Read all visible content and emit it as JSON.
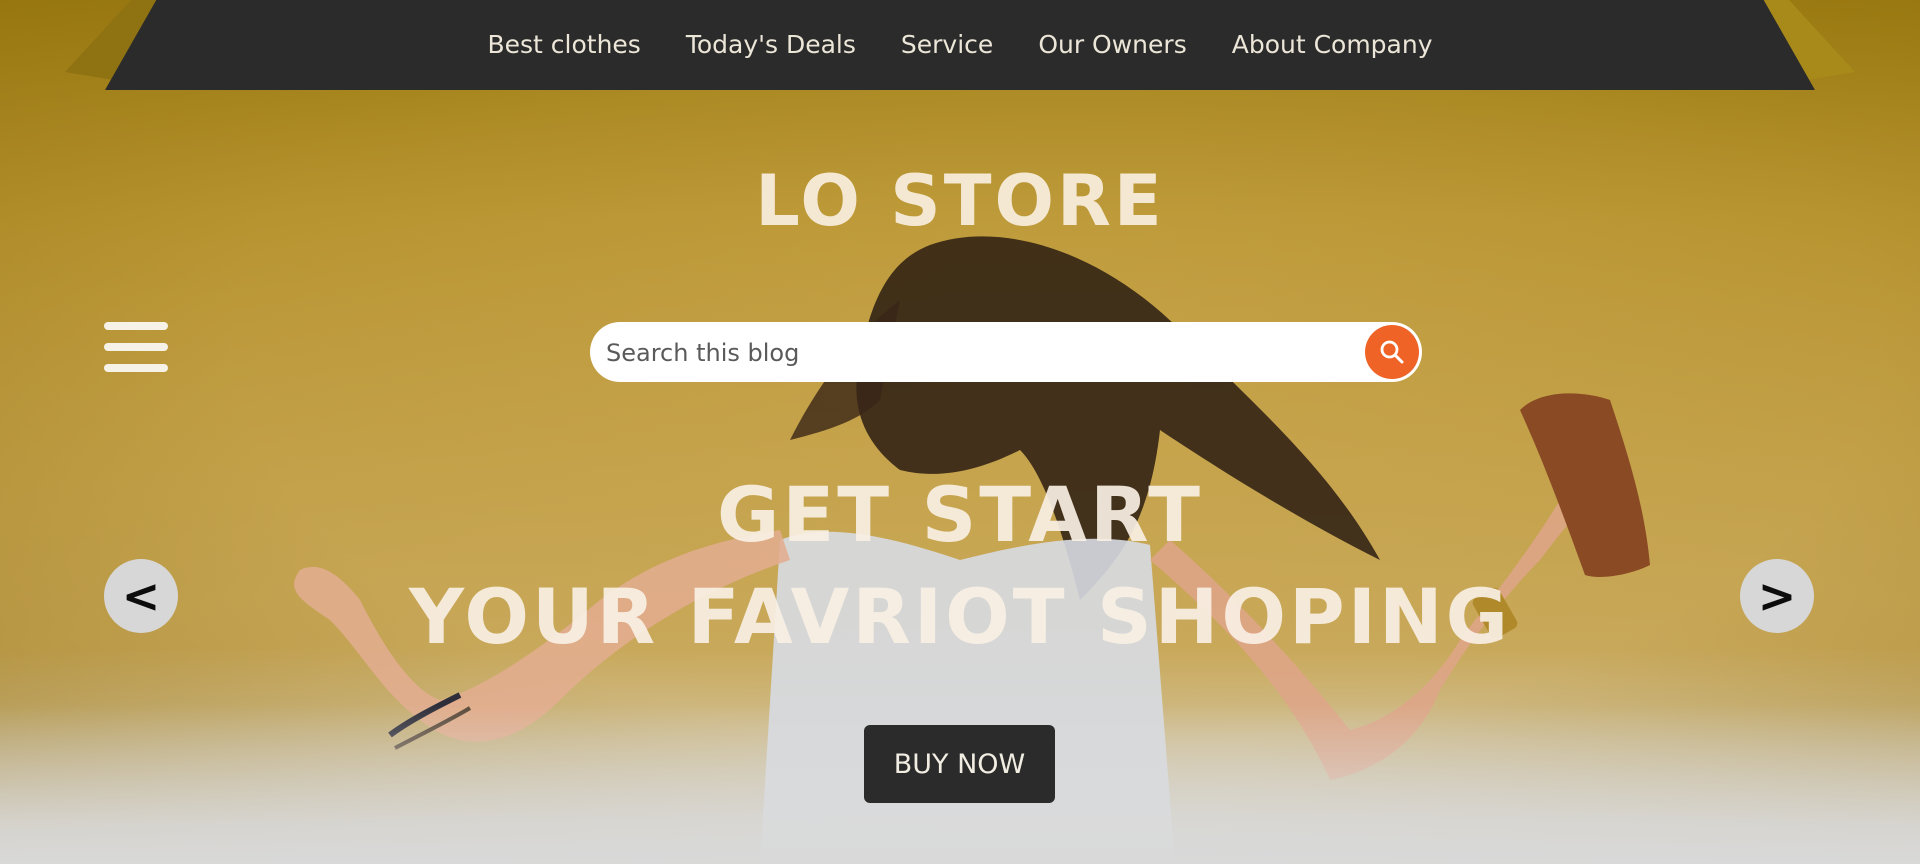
{
  "nav": {
    "items": [
      {
        "label": "Best clothes"
      },
      {
        "label": "Today's Deals"
      },
      {
        "label": "Service"
      },
      {
        "label": "Our Owners"
      },
      {
        "label": "About Company"
      }
    ]
  },
  "brand": {
    "title": "LO STORE"
  },
  "menu": {
    "icon": "hamburger-menu-icon"
  },
  "search": {
    "placeholder": "Search this blog",
    "value": "",
    "icon": "search-icon"
  },
  "hero": {
    "headline_line1": "GET START",
    "headline_line2": "YOUR FAVRIOT SHOPING",
    "cta_label": "BUY NOW",
    "prev_label": "<",
    "next_label": ">"
  },
  "colors": {
    "nav_bg": "#2b2b2b",
    "accent": "#ef6426",
    "hero_bg": "#c3a14a",
    "text_light": "#f4e8d2"
  }
}
